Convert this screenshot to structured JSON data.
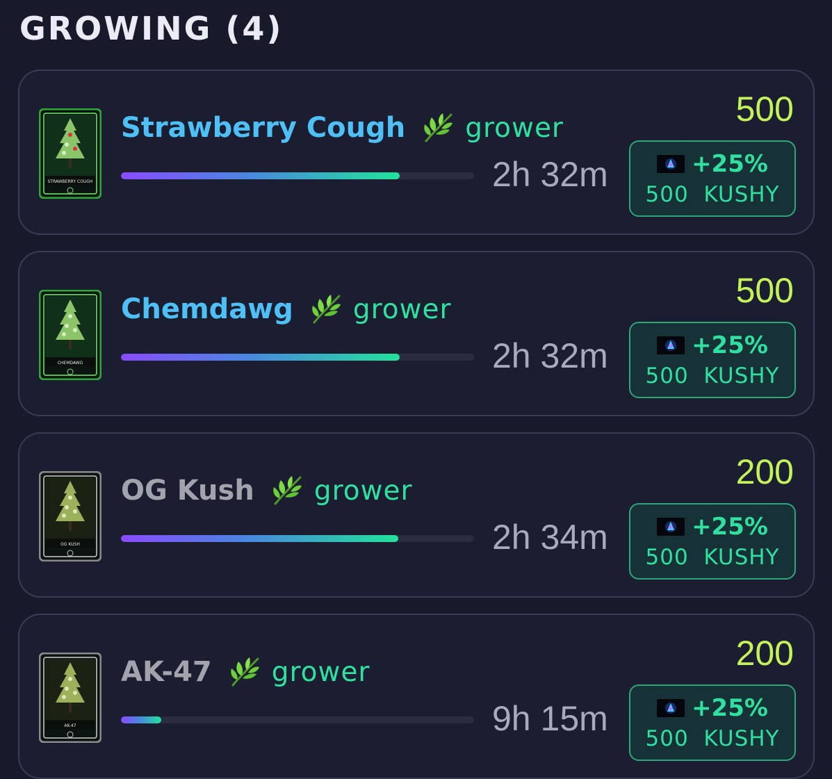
{
  "section": {
    "title": "GROWING (4)"
  },
  "colors": {
    "background": "#181a2c",
    "card_border": "#3a3c55",
    "name_rare": "#4fc0f5",
    "name_common": "#a3a3ad",
    "grower": "#2fe0a0",
    "reward": "#c4f25a",
    "time": "#a9abbd"
  },
  "plants": [
    {
      "card_label": "STRAWBERRY COUGH",
      "name": "Strawberry Cough",
      "rarity": "rare",
      "role": "grower",
      "leaf_icon": "herb-leaf-icon",
      "progress": 0.79,
      "time_left": "2h 32m",
      "reward": "500",
      "bonus": {
        "token_icon": "kushy-token-icon",
        "percent": "+25%",
        "amount": "500",
        "currency": "KUSHY"
      }
    },
    {
      "card_label": "CHEMDAWG",
      "name": "Chemdawg",
      "rarity": "rare",
      "role": "grower",
      "leaf_icon": "herb-leaf-icon",
      "progress": 0.79,
      "time_left": "2h 32m",
      "reward": "500",
      "bonus": {
        "token_icon": "kushy-token-icon",
        "percent": "+25%",
        "amount": "500",
        "currency": "KUSHY"
      }
    },
    {
      "card_label": "OG KUSH",
      "name": "OG Kush",
      "rarity": "common",
      "role": "grower",
      "leaf_icon": "herb-leaf-icon",
      "progress": 0.785,
      "time_left": "2h 34m",
      "reward": "200",
      "bonus": {
        "token_icon": "kushy-token-icon",
        "percent": "+25%",
        "amount": "500",
        "currency": "KUSHY"
      }
    },
    {
      "card_label": "AK-47",
      "name": "AK-47",
      "rarity": "common",
      "role": "grower",
      "leaf_icon": "herb-leaf-icon",
      "progress": 0.115,
      "time_left": "9h 15m",
      "reward": "200",
      "bonus": {
        "token_icon": "kushy-token-icon",
        "percent": "+25%",
        "amount": "500",
        "currency": "KUSHY"
      }
    }
  ]
}
